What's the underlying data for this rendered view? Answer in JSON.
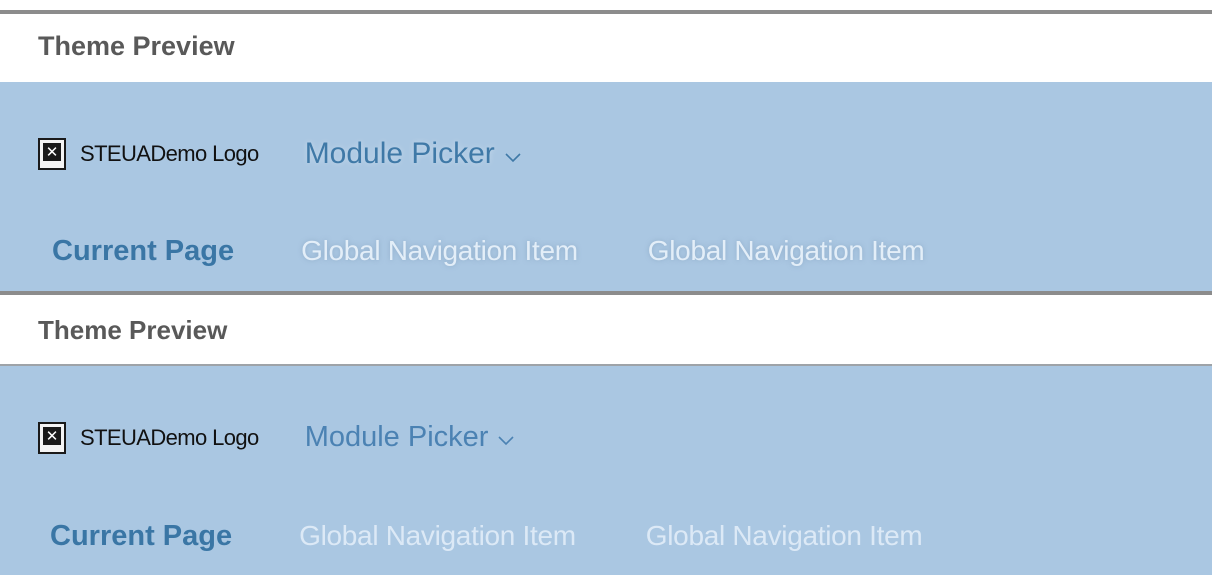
{
  "previews": [
    {
      "title": "Theme Preview",
      "logo_text": "STEUADemo Logo",
      "module_picker": "Module Picker",
      "nav": {
        "current": "Current Page",
        "items": [
          "Global Navigation Item",
          "Global Navigation Item"
        ]
      }
    },
    {
      "title": "Theme Preview",
      "logo_text": "STEUADemo Logo",
      "module_picker": "Module Picker",
      "nav": {
        "current": "Current Page",
        "items": [
          "Global Navigation Item",
          "Global Navigation Item"
        ]
      }
    }
  ],
  "icons": {
    "logo": "broken-image-icon",
    "module_picker": "chevron-down-icon"
  },
  "colors": {
    "header_bg": "#aac7e2",
    "accent": "#3a76a5",
    "title_text": "#595959"
  }
}
